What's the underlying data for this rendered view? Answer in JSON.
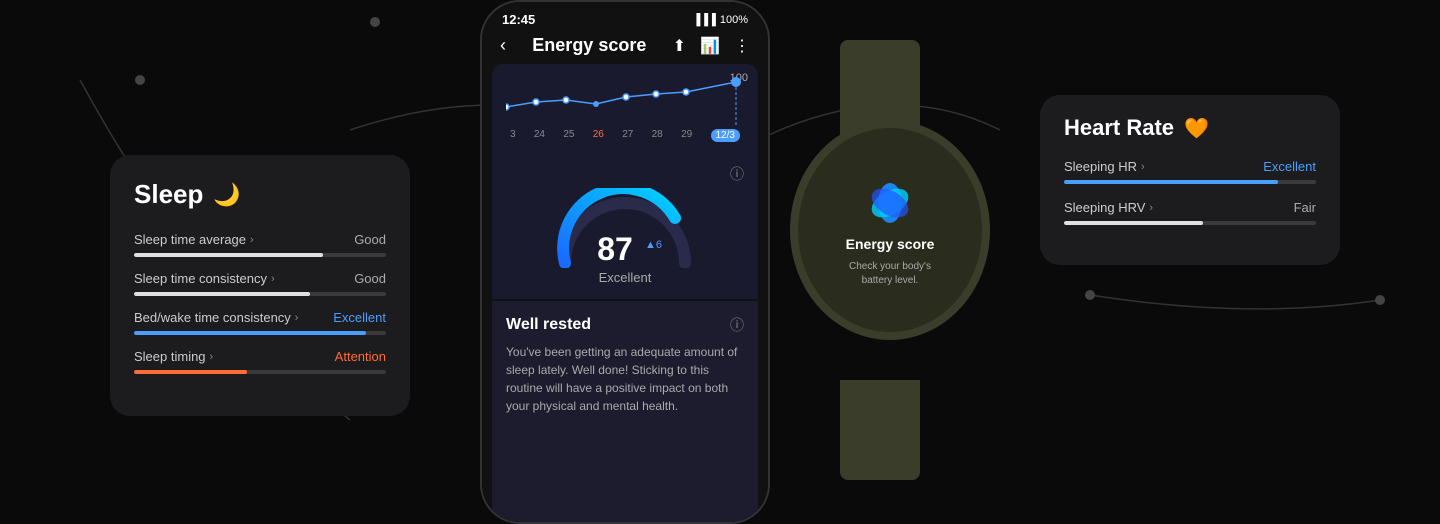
{
  "background": "#0a0a0a",
  "sleep_card": {
    "title": "Sleep",
    "icon": "🌙",
    "metrics": [
      {
        "label": "Sleep time average",
        "value": "Good",
        "value_class": "",
        "fill_width": 75,
        "fill_class": "fill-white"
      },
      {
        "label": "Sleep time consistency",
        "value": "Good",
        "value_class": "",
        "fill_width": 70,
        "fill_class": "fill-white"
      },
      {
        "label": "Bed/wake time consistency",
        "value": "Excellent",
        "value_class": "excellent",
        "fill_width": 92,
        "fill_class": "fill-blue"
      },
      {
        "label": "Sleep timing",
        "value": "Attention",
        "value_class": "attention",
        "fill_width": 45,
        "fill_class": "fill-orange"
      }
    ]
  },
  "phone": {
    "status_time": "12:45",
    "status_battery": "100%",
    "nav_title": "Energy score",
    "chart_dates": [
      "3",
      "24",
      "25",
      "26",
      "27",
      "28",
      "29",
      "12/3"
    ],
    "chart_active_date": "12/3",
    "chart_label_100": "100",
    "score_value": "87",
    "score_delta": "▲ 6",
    "score_label": "Excellent",
    "info_icon": "ⓘ",
    "well_rested_title": "Well rested",
    "well_rested_body": "You've been getting an adequate amount of sleep lately. Well done! Sticking to this routine will have a positive impact on both your physical and mental health."
  },
  "watch": {
    "energy_title": "Energy score",
    "energy_sub": "Check your body's\nbattery level."
  },
  "heart_rate_card": {
    "title": "Heart Rate",
    "heart_icon": "🧡",
    "metrics": [
      {
        "label": "Sleeping HR",
        "value": "Excellent",
        "value_class": "hr-value-excellent",
        "fill_width": 85,
        "fill_class": "fill-blue"
      },
      {
        "label": "Sleeping HRV",
        "value": "Fair",
        "value_class": "hr-value-fair",
        "fill_width": 55,
        "fill_class": "fill-white"
      }
    ]
  }
}
